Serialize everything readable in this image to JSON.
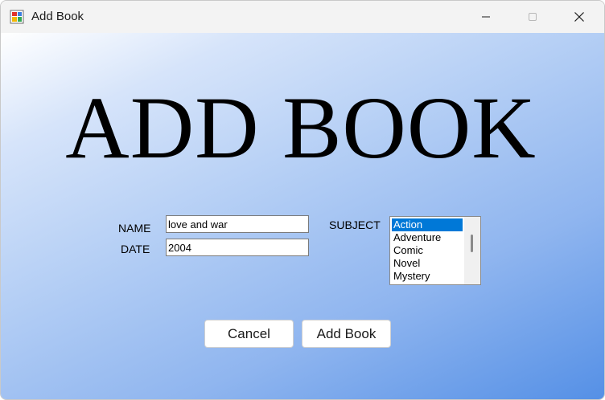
{
  "window": {
    "title": "Add Book",
    "controls": {
      "minimize": "minimize",
      "maximize": "maximize",
      "close": "close"
    }
  },
  "form": {
    "heading": "ADD BOOK",
    "name_label": "NAME",
    "name_value": "love and war",
    "date_label": "DATE",
    "date_value": "2004",
    "subject_label": "SUBJECT",
    "subject_options": [
      "Action",
      "Adventure",
      "Comic",
      "Novel",
      "Mystery"
    ],
    "subject_selected": "Action"
  },
  "buttons": {
    "cancel": "Cancel",
    "add": "Add Book"
  },
  "colors": {
    "selection": "#0078d7",
    "gradient_start": "#ffffff",
    "gradient_end": "#5590e6"
  },
  "icons": {
    "app": "form-app-icon",
    "minimize": "minimize-icon",
    "maximize": "maximize-icon",
    "close": "close-icon"
  }
}
